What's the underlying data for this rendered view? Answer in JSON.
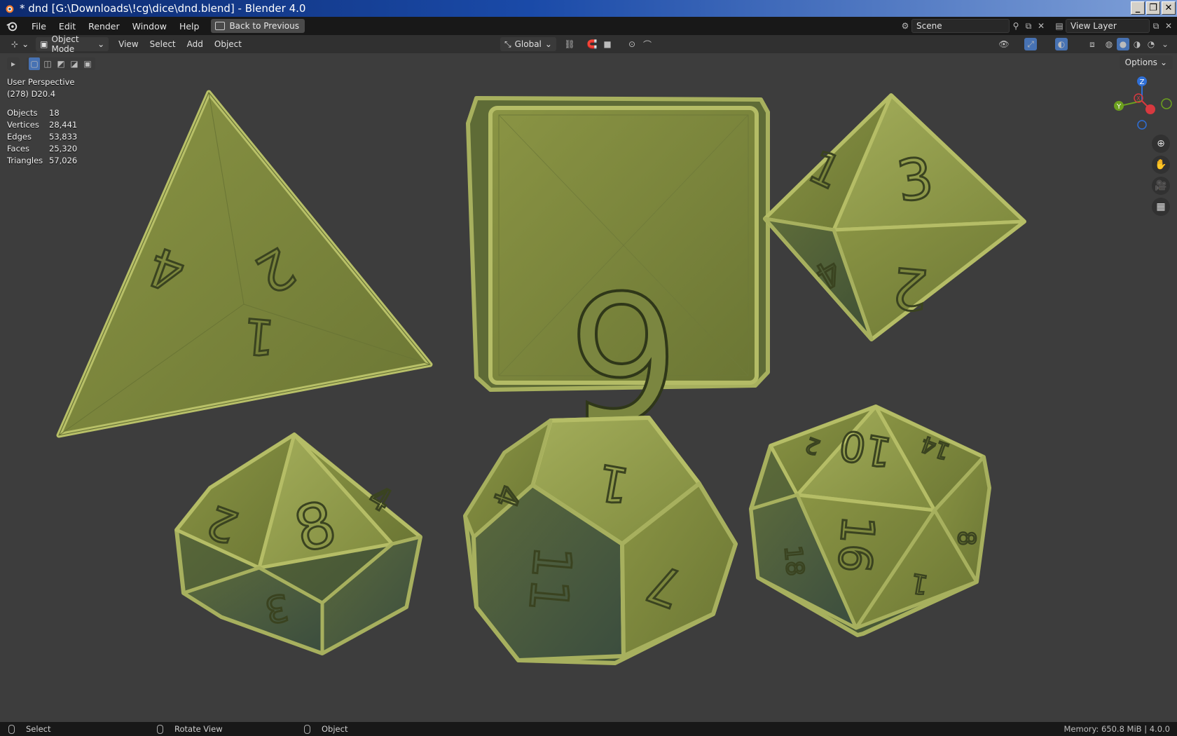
{
  "window": {
    "title": "* dnd [G:\\Downloads\\!cg\\dice\\dnd.blend] - Blender 4.0",
    "controls": [
      "minimize",
      "restore",
      "close"
    ]
  },
  "menubar": {
    "items": [
      "File",
      "Edit",
      "Render",
      "Window",
      "Help"
    ],
    "back_button": "Back to Previous",
    "scene_name": "Scene",
    "view_layer": "View Layer"
  },
  "viewport_header": {
    "mode": "Object Mode",
    "menus": [
      "View",
      "Select",
      "Add",
      "Object"
    ],
    "transform_orientation": "Global",
    "options_label": "Options"
  },
  "viewport_overlay": {
    "perspective": "User Perspective",
    "active_object": "(278) D20.4",
    "stats": [
      {
        "label": "Objects",
        "value": "18"
      },
      {
        "label": "Vertices",
        "value": "28,441"
      },
      {
        "label": "Edges",
        "value": "53,833"
      },
      {
        "label": "Faces",
        "value": "25,320"
      },
      {
        "label": "Triangles",
        "value": "57,026"
      }
    ]
  },
  "gizmo": {
    "axes": [
      "Z",
      "Y",
      "X"
    ],
    "colors": {
      "x": "#d7393f",
      "y": "#6ca01e",
      "z": "#2f6fd6"
    }
  },
  "dice": {
    "d4": [
      "4",
      "2",
      "1"
    ],
    "d6": [
      "6"
    ],
    "d8": [
      "3",
      "1",
      "2",
      "4"
    ],
    "d10": [
      "8",
      "2",
      "4",
      "3"
    ],
    "d12": [
      "1",
      "4",
      "11",
      "7"
    ],
    "d20": [
      "10",
      "14",
      "16",
      "8",
      "1",
      "18",
      "2"
    ],
    "color": "#8c9845"
  },
  "statusbar": {
    "select": "Select",
    "rotate": "Rotate View",
    "object": "Object",
    "memory": "Memory: 650.8 MiB | 4.0.0"
  }
}
